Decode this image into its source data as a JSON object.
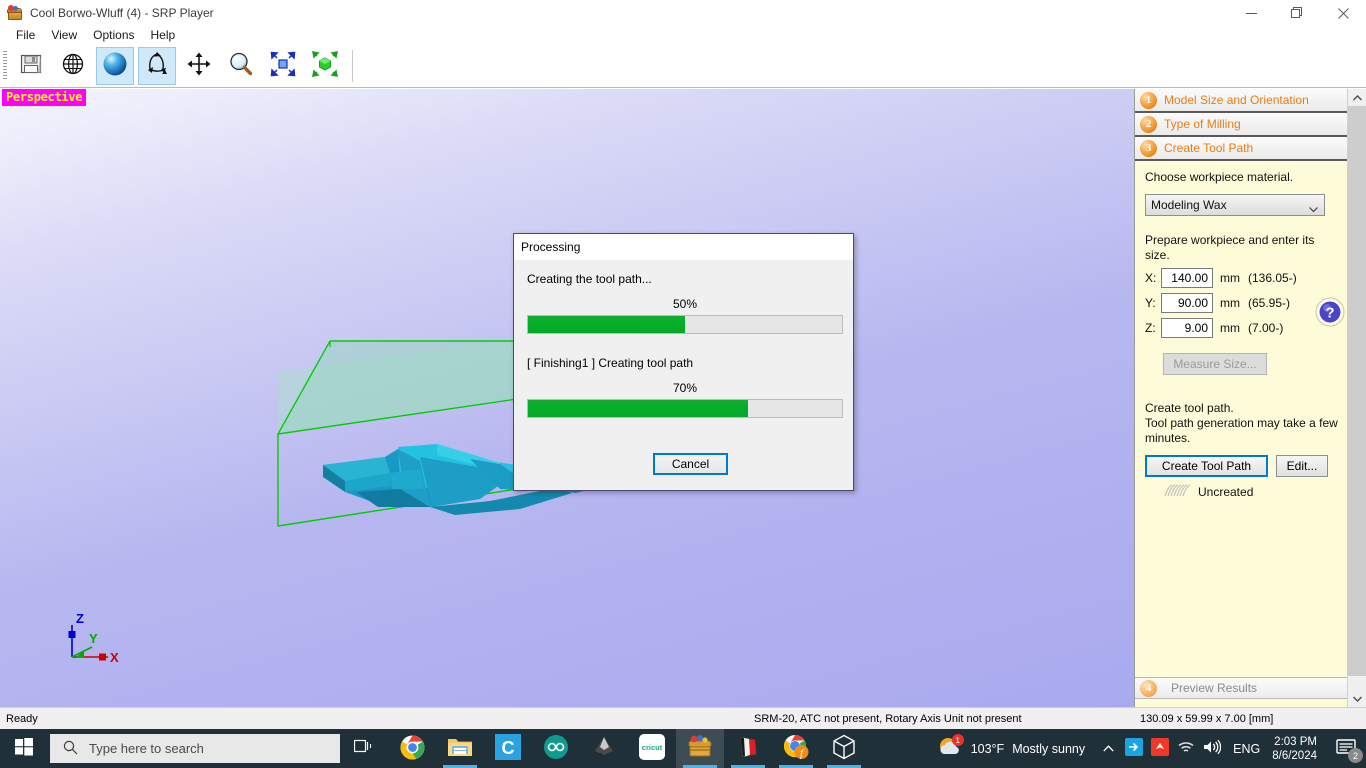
{
  "window": {
    "title": "Cool Borwo-Wluff (4) - SRP Player",
    "icon": "srp-player-icon",
    "minimize_label": "Minimize",
    "restore_label": "Restore",
    "close_label": "Close"
  },
  "menu": {
    "items": [
      {
        "label": "File"
      },
      {
        "label": "View"
      },
      {
        "label": "Options"
      },
      {
        "label": "Help"
      }
    ]
  },
  "toolbar": {
    "buttons": [
      {
        "name": "save-button",
        "icon": "floppy-disk-icon",
        "active": false
      },
      {
        "name": "globe-button",
        "icon": "globe-icon",
        "active": false
      },
      {
        "name": "shading-button",
        "icon": "sphere-icon",
        "active": true
      },
      {
        "name": "rotate-button",
        "icon": "rotate-arrows-icon",
        "active": true
      },
      {
        "name": "pan-button",
        "icon": "move-arrows-icon",
        "active": false
      },
      {
        "name": "zoom-button",
        "icon": "magnifier-icon",
        "active": false
      },
      {
        "name": "zoom-window-button",
        "icon": "zoom-window-icon",
        "active": false
      },
      {
        "name": "fit-view-button",
        "icon": "fit-cube-icon",
        "active": false
      }
    ]
  },
  "viewport": {
    "projection_label": "Perspective",
    "projection_bg": "#ff00ff",
    "projection_fg": "#ffff00",
    "axis": {
      "x": "X",
      "y": "Y",
      "z": "Z"
    },
    "model_color": "#18a8cf",
    "workpiece_edge_color": "#00cc00"
  },
  "dialog": {
    "title": "Processing",
    "overall_label": "Creating the tool path...",
    "overall_percent_label": "50%",
    "overall_percent": 50,
    "task_label": "[ Finishing1 ] Creating tool path",
    "task_percent_label": "70%",
    "task_percent": 70,
    "cancel_label": "Cancel",
    "progress_color": "#06a828"
  },
  "panel": {
    "steps": [
      {
        "num": "1",
        "label": "Model Size and Orientation"
      },
      {
        "num": "2",
        "label": "Type of Milling"
      },
      {
        "num": "3",
        "label": "Create Tool Path"
      }
    ],
    "material_prompt": "Choose workpiece material.",
    "material_value": "Modeling Wax",
    "size_prompt": "Prepare workpiece and enter its size.",
    "sizes": [
      {
        "axis": "X:",
        "value": "140.00",
        "unit": "mm",
        "range": "(136.05-)"
      },
      {
        "axis": "Y:",
        "value": "90.00",
        "unit": "mm",
        "range": "(65.95-)"
      },
      {
        "axis": "Z:",
        "value": "9.00",
        "unit": "mm",
        "range": "(7.00-)"
      }
    ],
    "measure_label": "Measure Size...",
    "create_prompt_line1": "Create tool path.",
    "create_prompt_line2": "Tool path generation may take a few",
    "create_prompt_line3": "minutes.",
    "create_tool_path_label": "Create Tool Path",
    "edit_label": "Edit...",
    "status_label": "Uncreated",
    "help_icon": "help-question-icon",
    "preview_step_num": "4",
    "preview_label": "Preview Results",
    "accent_color": "#e87d17",
    "panel_bg": "#fdfbd8"
  },
  "statusbar": {
    "ready": "Ready",
    "machine": "SRM-20, ATC not present, Rotary Axis Unit not present",
    "dimensions": "130.09 x  59.99 x   7.00 [mm]"
  },
  "taskbar": {
    "start_label": "Start",
    "search_placeholder": "Type here to search",
    "search_icon": "search-icon",
    "task_view_icon": "task-view-icon",
    "apps": [
      {
        "name": "chrome",
        "label": "Google Chrome",
        "running": false,
        "active": false
      },
      {
        "name": "file-explorer",
        "label": "File Explorer",
        "running": true,
        "active": false
      },
      {
        "name": "carbide-create",
        "label": "Carbide Create",
        "running": false,
        "active": false
      },
      {
        "name": "arduino",
        "label": "Arduino IDE",
        "running": false,
        "active": false
      },
      {
        "name": "inkscape",
        "label": "Inkscape",
        "running": false,
        "active": false
      },
      {
        "name": "cricut",
        "label": "Cricut Design Space",
        "running": false,
        "active": false
      },
      {
        "name": "srp-player",
        "label": "SRP Player",
        "running": true,
        "active": true
      },
      {
        "name": "vcarve",
        "label": "VCarve",
        "running": true,
        "active": false
      },
      {
        "name": "chrome-profile",
        "label": "Chrome Profile",
        "running": true,
        "active": false
      },
      {
        "name": "3d-builder",
        "label": "3D Builder",
        "running": true,
        "active": false
      }
    ],
    "weather": {
      "temperature": "103°F",
      "condition": "Mostly sunny",
      "icon": "sun-cloud-icon",
      "badge": "1"
    },
    "tray": {
      "chevron_icon": "chevron-up-icon",
      "icons": [
        {
          "name": "share-tray-icon"
        },
        {
          "name": "red-app-tray-icon"
        },
        {
          "name": "wifi-icon"
        },
        {
          "name": "volume-icon"
        }
      ],
      "language": "ENG",
      "time": "2:03 PM",
      "date": "8/6/2024",
      "action_center_icon": "action-center-icon",
      "action_center_badge": "2"
    }
  }
}
